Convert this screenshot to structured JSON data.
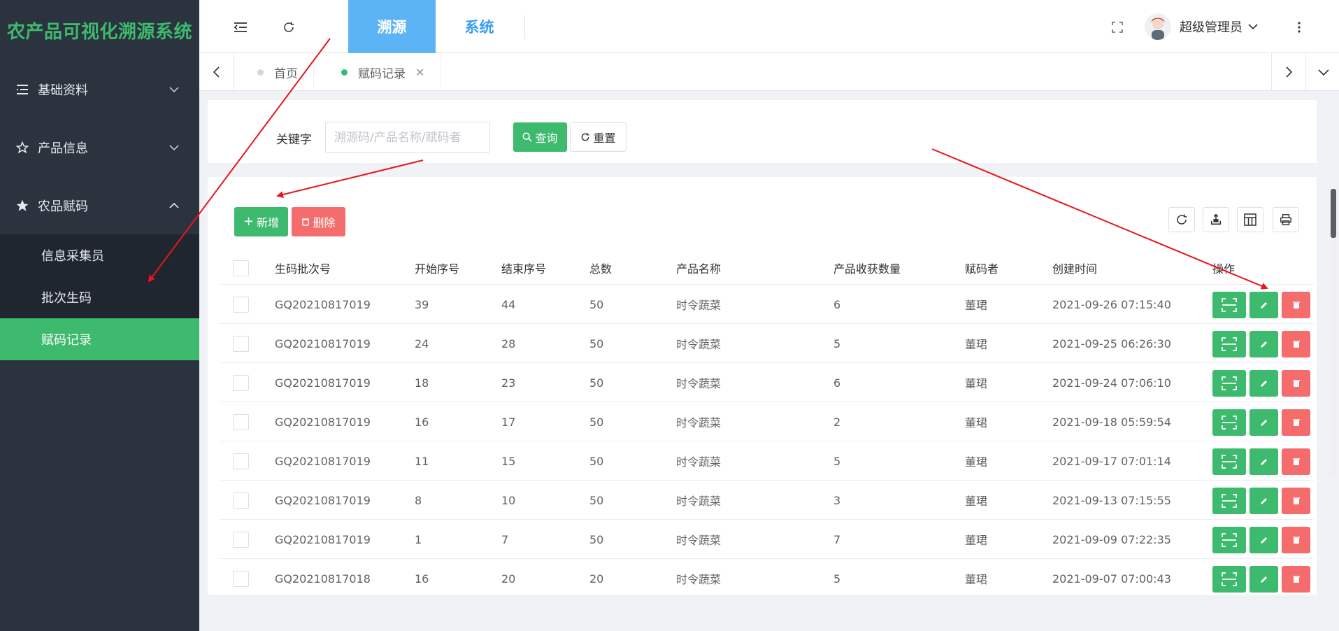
{
  "sidebar": {
    "logo": "农产品可视化溯源系统",
    "menu": [
      {
        "label": "基础资料",
        "icon": "list-icon",
        "expanded": false
      },
      {
        "label": "产品信息",
        "icon": "star-icon",
        "expanded": false
      },
      {
        "label": "农品赋码",
        "icon": "star-icon",
        "expanded": true
      }
    ],
    "submenu": [
      {
        "label": "信息采集员",
        "active": false
      },
      {
        "label": "批次生码",
        "active": false
      },
      {
        "label": "赋码记录",
        "active": true
      }
    ]
  },
  "header": {
    "tabs": [
      {
        "label": "溯源",
        "active": true
      },
      {
        "label": "系统",
        "active": false
      }
    ],
    "user": "超级管理员"
  },
  "tags": [
    {
      "label": "首页",
      "active": false
    },
    {
      "label": "赋码记录",
      "active": true,
      "closable": true
    }
  ],
  "search": {
    "label": "关键字",
    "placeholder": "溯源码/产品名称/赋码者",
    "value": "",
    "query_label": "查询",
    "reset_label": "重置"
  },
  "toolbar": {
    "add_label": "新增",
    "delete_label": "删除"
  },
  "table": {
    "headers": [
      "生码批次号",
      "开始序号",
      "结束序号",
      "总数",
      "产品名称",
      "产品收获数量",
      "赋码者",
      "创建时间",
      "操作"
    ],
    "rows": [
      [
        "GQ20210817019",
        "39",
        "44",
        "50",
        "时令蔬菜",
        "6",
        "董珺",
        "2021-09-26 07:15:40"
      ],
      [
        "GQ20210817019",
        "24",
        "28",
        "50",
        "时令蔬菜",
        "5",
        "董珺",
        "2021-09-25 06:26:30"
      ],
      [
        "GQ20210817019",
        "18",
        "23",
        "50",
        "时令蔬菜",
        "6",
        "董珺",
        "2021-09-24 07:06:10"
      ],
      [
        "GQ20210817019",
        "16",
        "17",
        "50",
        "时令蔬菜",
        "2",
        "董珺",
        "2021-09-18 05:59:54"
      ],
      [
        "GQ20210817019",
        "11",
        "15",
        "50",
        "时令蔬菜",
        "5",
        "董珺",
        "2021-09-17 07:01:14"
      ],
      [
        "GQ20210817019",
        "8",
        "10",
        "50",
        "时令蔬菜",
        "3",
        "董珺",
        "2021-09-13 07:15:55"
      ],
      [
        "GQ20210817019",
        "1",
        "7",
        "50",
        "时令蔬菜",
        "7",
        "董珺",
        "2021-09-09 07:22:35"
      ],
      [
        "GQ20210817018",
        "16",
        "20",
        "20",
        "时令蔬菜",
        "5",
        "董珺",
        "2021-09-07 07:00:43"
      ]
    ]
  },
  "colors": {
    "brand": "#3dba6d",
    "danger": "#f56c6c",
    "tab_active": "#5cb4f4",
    "sidebar_bg": "#2b333e",
    "annotation": "#e8161c"
  }
}
